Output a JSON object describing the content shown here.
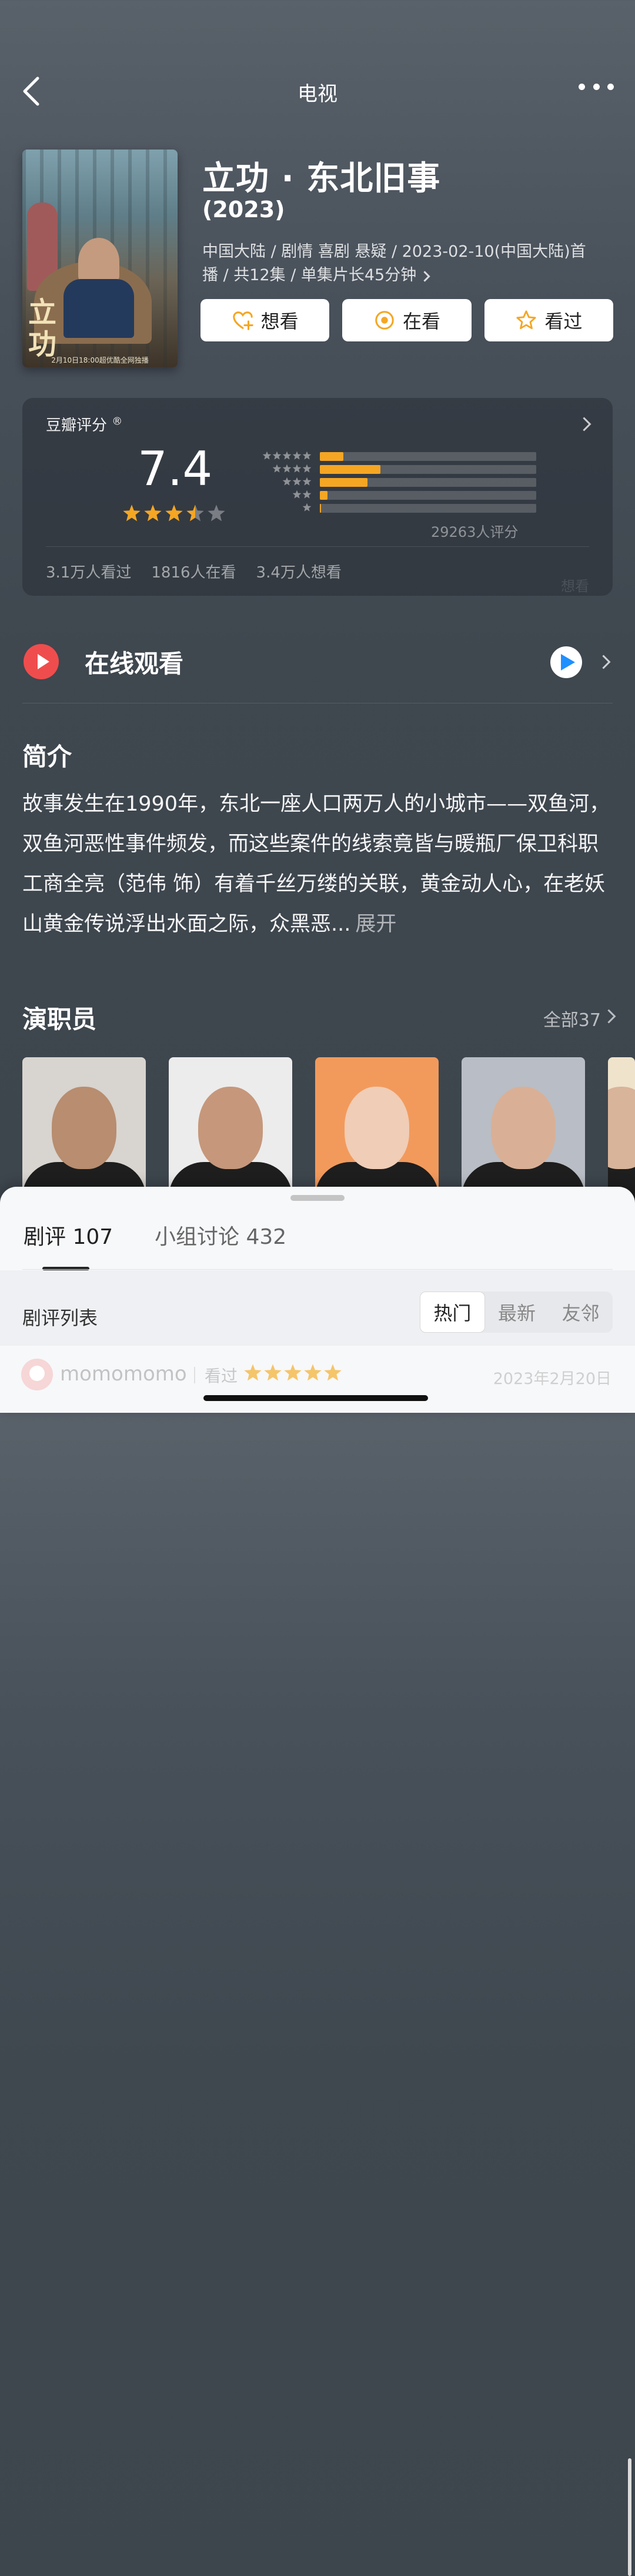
{
  "topbar": {
    "title": "电视"
  },
  "movie": {
    "title": "立功 · 东北旧事",
    "year": "(2023)",
    "meta_line1": "中国大陆 / 剧情 喜剧 悬疑 / 2023-02-10(中国大陆)首",
    "meta_line2": "播 / 共12集 / 单集片长45分钟",
    "poster_text": "立功",
    "poster_date": "2月10日18:00超优酷全网独播"
  },
  "actions": {
    "want": "想看",
    "watching": "在看",
    "watched": "看过"
  },
  "rating": {
    "label": "豆瓣评分",
    "reg": "®",
    "score": "7.4",
    "stars": 3.5,
    "count_text": "29263人评分",
    "distribution": [
      {
        "stars": 5,
        "percent": 0.11
      },
      {
        "stars": 4,
        "percent": 0.28
      },
      {
        "stars": 3,
        "percent": 0.22
      },
      {
        "stars": 2,
        "percent": 0.035
      },
      {
        "stars": 1,
        "percent": 0.006
      }
    ],
    "watched": "3.1万人看过",
    "watching": "1816人在看",
    "wish": "3.4万人想看",
    "watermark": "想看"
  },
  "online": {
    "title": "在线观看"
  },
  "synopsis": {
    "title": "简介",
    "text": "故事发生在1990年，东北一座人口两万人的小城市——双鱼河，双鱼河恶性事件频发，而这些案件的线索竟皆与暖瓶厂保卫科职工商全亮（范伟 饰）有着千丝万缕的关联，黄金动人心，在老妖山黄金传说浮出水面之际，众黑恶...",
    "more": "展开"
  },
  "cast": {
    "title": "演职员",
    "all": "全部37",
    "photos": [
      {
        "bg": "#d8d4cf",
        "face": "#b88d70"
      },
      {
        "bg": "#ececec",
        "face": "#c6977b"
      },
      {
        "bg": "#f29a5c",
        "face": "#f0cdb6"
      },
      {
        "bg": "#b9bdc5",
        "face": "#d9b096"
      },
      {
        "bg": "#efe3cc",
        "face": "#d8b49a"
      }
    ]
  },
  "sheet": {
    "tab_reviews": "剧评 107",
    "tab_groups": "小组讨论 432",
    "list_label": "剧评列表",
    "filters": [
      "热门",
      "最新",
      "友邻"
    ],
    "review": {
      "user": "momomomo",
      "status": "看过",
      "stars": 5,
      "date": "2023年2月20日"
    }
  },
  "colors": {
    "accent": "#f5a623",
    "play": "#ef4d4d"
  }
}
